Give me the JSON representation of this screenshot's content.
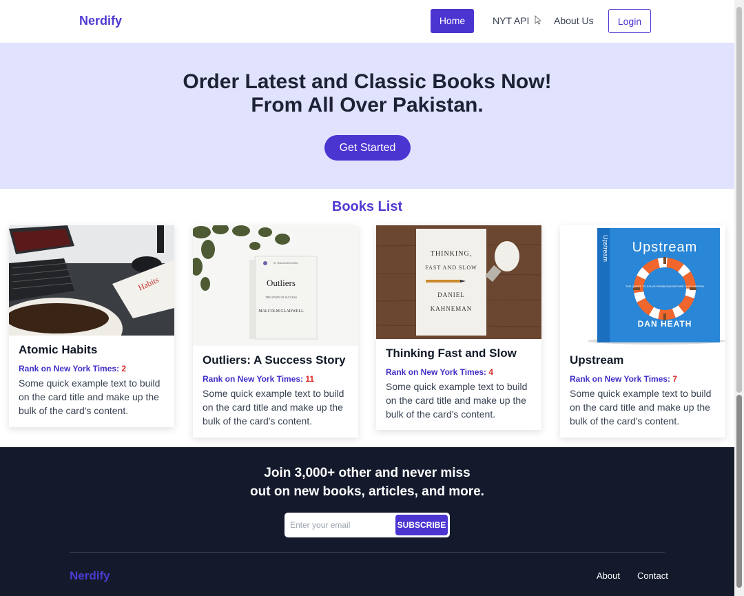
{
  "nav": {
    "brand": "Nerdify",
    "home": "Home",
    "nyt": "NYT API",
    "about": "About Us",
    "login": "Login"
  },
  "hero": {
    "line1": "Order Latest and Classic Books Now!",
    "line2": "From All Over Pakistan.",
    "cta": "Get Started"
  },
  "books": {
    "heading": "Books List",
    "rank_label": "Rank on New York Times: ",
    "items": [
      {
        "title": "Atomic Habits",
        "rank": "2",
        "text": "Some quick example text to build on the card title and make up the bulk of the card's content."
      },
      {
        "title": "Outliers: A Success Story",
        "rank": "11",
        "text": "Some quick example text to build on the card title and make up the bulk of the card's content."
      },
      {
        "title": "Thinking Fast and Slow",
        "rank": "4",
        "text": "Some quick example text to build on the card title and make up the bulk of the card's content."
      },
      {
        "title": "Upstream",
        "rank": "7",
        "text": "Some quick example text to build on the card title and make up the bulk of the card's content."
      }
    ],
    "covers": {
      "outliers": {
        "small": "#1 National Bestseller",
        "title": "Outliers",
        "sub": "THE STORY OF SUCCESS",
        "author": "MALCOLM GLADWELL"
      },
      "thinking": {
        "title1": "THINKING,",
        "title2": "FAST AND SLOW",
        "author1": "DANIEL",
        "author2": "KAHNEMAN"
      },
      "upstream": {
        "title": "Upstream",
        "spine": "Upstream",
        "tag": "THE QUEST TO SOLVE PROBLEMS BEFORE THEY HAPPEN",
        "author": "DAN HEATH"
      }
    }
  },
  "footer": {
    "line1": "Join 3,000+ other and never miss",
    "line2": "out on new books, articles, and more.",
    "email_placeholder": "Enter your email",
    "subscribe": "SUBSCRIBE",
    "brand": "Nerdify",
    "about": "About",
    "contact": "Contact"
  },
  "colors": {
    "accent": "#4b35d1",
    "hero_bg": "#e0e2fe",
    "footer_bg": "#141a2c",
    "rank_number": "#dc2626"
  }
}
